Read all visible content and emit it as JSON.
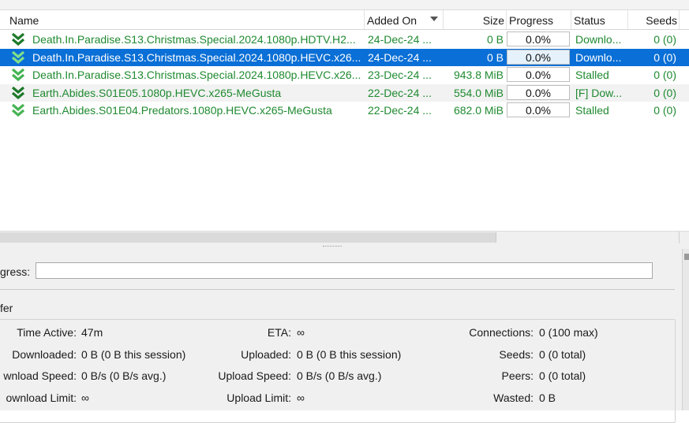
{
  "columns": {
    "name": "Name",
    "added_on": "Added On",
    "size": "Size",
    "progress": "Progress",
    "status": "Status",
    "seeds": "Seeds"
  },
  "torrents": [
    {
      "name": "Death.In.Paradise.S13.Christmas.Special.2024.1080p.HDTV.H2...",
      "added": "24-Dec-24 ...",
      "size": "0 B",
      "progress": "0.0%",
      "progress_value": 0.0,
      "status": "Downlo...",
      "seeds": "0 (0)",
      "icon": "download-icon",
      "selected": false
    },
    {
      "name": "Death.In.Paradise.S13.Christmas.Special.2024.1080p.HEVC.x26...",
      "added": "24-Dec-24 ...",
      "size": "0 B",
      "progress": "0.0%",
      "progress_value": 0.0,
      "status": "Downlo...",
      "seeds": "0 (0)",
      "icon": "download-icon",
      "selected": true
    },
    {
      "name": "Death.In.Paradise.S13.Christmas.Special.2024.1080p.HEVC.x26...",
      "added": "23-Dec-24 ...",
      "size": "943.8 MiB",
      "progress": "0.0%",
      "progress_value": 0.0,
      "status": "Stalled",
      "seeds": "0 (0)",
      "icon": "stalled-download-icon",
      "selected": false
    },
    {
      "name": "Earth.Abides.S01E05.1080p.HEVC.x265-MeGusta",
      "added": "22-Dec-24 ...",
      "size": "554.0 MiB",
      "progress": "0.0%",
      "progress_value": 0.0,
      "status": "[F] Dow...",
      "seeds": "0 (0)",
      "icon": "forced-download-icon",
      "selected": false
    },
    {
      "name": "Earth.Abides.S01E04.Predators.1080p.HEVC.x265-MeGusta",
      "added": "22-Dec-24 ...",
      "size": "682.0 MiB",
      "progress": "0.0%",
      "progress_value": 0.0,
      "status": "Stalled",
      "seeds": "0 (0)",
      "icon": "stalled-download-icon",
      "selected": false
    }
  ],
  "details": {
    "progress_label": "gress:",
    "transfer_label": "fer",
    "time_active_label": "Time Active:",
    "time_active": "47m",
    "downloaded_label": "Downloaded:",
    "downloaded": "0 B (0 B this session)",
    "download_speed_label": "wnload Speed:",
    "download_speed": "0 B/s (0 B/s avg.)",
    "download_limit_label": "ownload Limit:",
    "download_limit": "∞",
    "eta_label": "ETA:",
    "eta": "∞",
    "uploaded_label": "Uploaded:",
    "uploaded": "0 B (0 B this session)",
    "upload_speed_label": "Upload Speed:",
    "upload_speed": "0 B/s (0 B/s avg.)",
    "upload_limit_label": "Upload Limit:",
    "upload_limit": "∞",
    "connections_label": "Connections:",
    "connections": "0 (100 max)",
    "seeds_label": "Seeds:",
    "seeds": "0 (0 total)",
    "peers_label": "Peers:",
    "peers": "0 (0 total)",
    "wasted_label": "Wasted:",
    "wasted": "0 B"
  },
  "colors": {
    "accent_selection": "#0a6fd6",
    "status_green": "#1f8a30",
    "progress_fill": "#06b025"
  }
}
